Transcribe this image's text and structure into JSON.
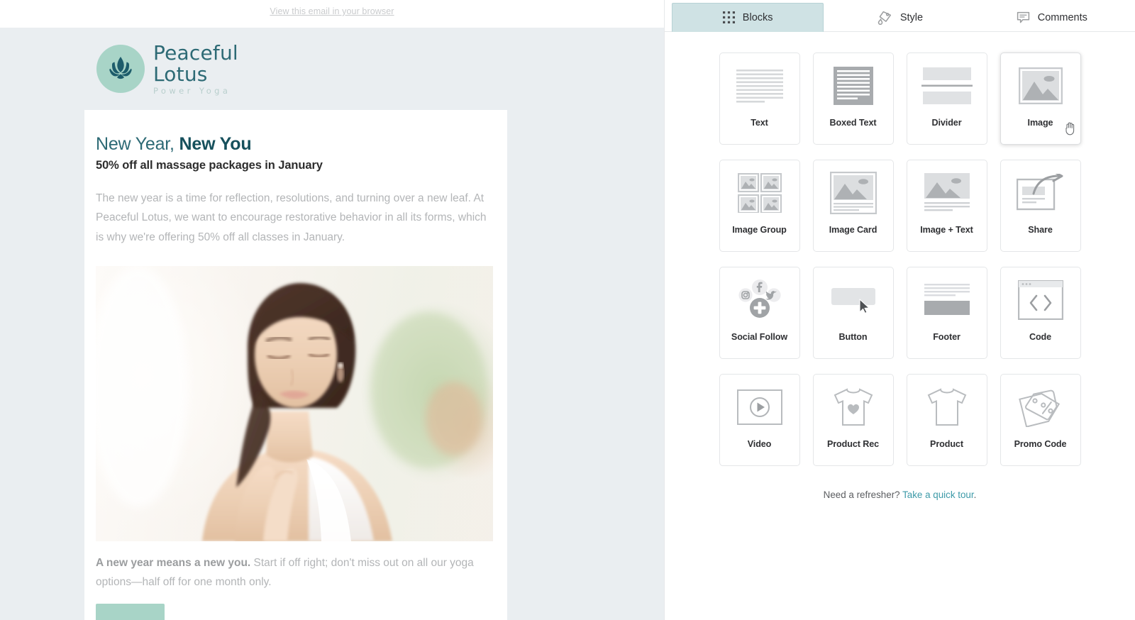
{
  "preview": {
    "browser_link": "View this email in your browser",
    "logo": {
      "icon": "lotus-icon",
      "line1": "Peaceful",
      "line2": "Lotus",
      "tagline": "Power Yoga",
      "mark_color": "#a8d4c7",
      "text_color": "#2d6a75"
    },
    "email": {
      "heading_plain": "New Year, ",
      "heading_bold": "New You",
      "subheading": "50% off all massage packages in January",
      "paragraph": "The new year is a time for reflection, resolutions, and turning over a new leaf. At Peaceful Lotus, we want to encourage restorative behavior in all its forms, which is why we're offering 50% off all classes in January.",
      "photo_alt": "woman meditating with hands in prayer pose",
      "caption_bold": "A new year means a new you.",
      "caption_rest": " Start if off right; don't miss out on all our yoga options—half off for one month only.",
      "cta_color": "#a8d4c7"
    }
  },
  "panel": {
    "tabs": [
      {
        "label": "Blocks",
        "icon": "grid-dots-icon",
        "active": true
      },
      {
        "label": "Style",
        "icon": "paint-tag-icon",
        "active": false
      },
      {
        "label": "Comments",
        "icon": "comment-bubble-icon",
        "active": false
      }
    ],
    "active_tab_color": "#cfe2e4",
    "blocks": [
      {
        "label": "Text",
        "icon": "text-lines-icon"
      },
      {
        "label": "Boxed Text",
        "icon": "boxed-text-icon"
      },
      {
        "label": "Divider",
        "icon": "divider-icon"
      },
      {
        "label": "Image",
        "icon": "image-icon",
        "hovered": true
      },
      {
        "label": "Image Group",
        "icon": "image-group-icon"
      },
      {
        "label": "Image Card",
        "icon": "image-card-icon"
      },
      {
        "label": "Image + Text",
        "icon": "image-text-icon"
      },
      {
        "label": "Share",
        "icon": "share-arrow-icon"
      },
      {
        "label": "Social Follow",
        "icon": "social-follow-icon"
      },
      {
        "label": "Button",
        "icon": "button-icon"
      },
      {
        "label": "Footer",
        "icon": "footer-icon"
      },
      {
        "label": "Code",
        "icon": "code-icon"
      },
      {
        "label": "Video",
        "icon": "video-play-icon"
      },
      {
        "label": "Product Rec",
        "icon": "tshirt-heart-icon"
      },
      {
        "label": "Product",
        "icon": "tshirt-icon"
      },
      {
        "label": "Promo Code",
        "icon": "promo-tag-icon"
      }
    ],
    "footer": {
      "prompt": "Need a refresher?",
      "link": "Take a quick tour",
      "period": ".",
      "link_color": "#3d9aa8"
    }
  }
}
